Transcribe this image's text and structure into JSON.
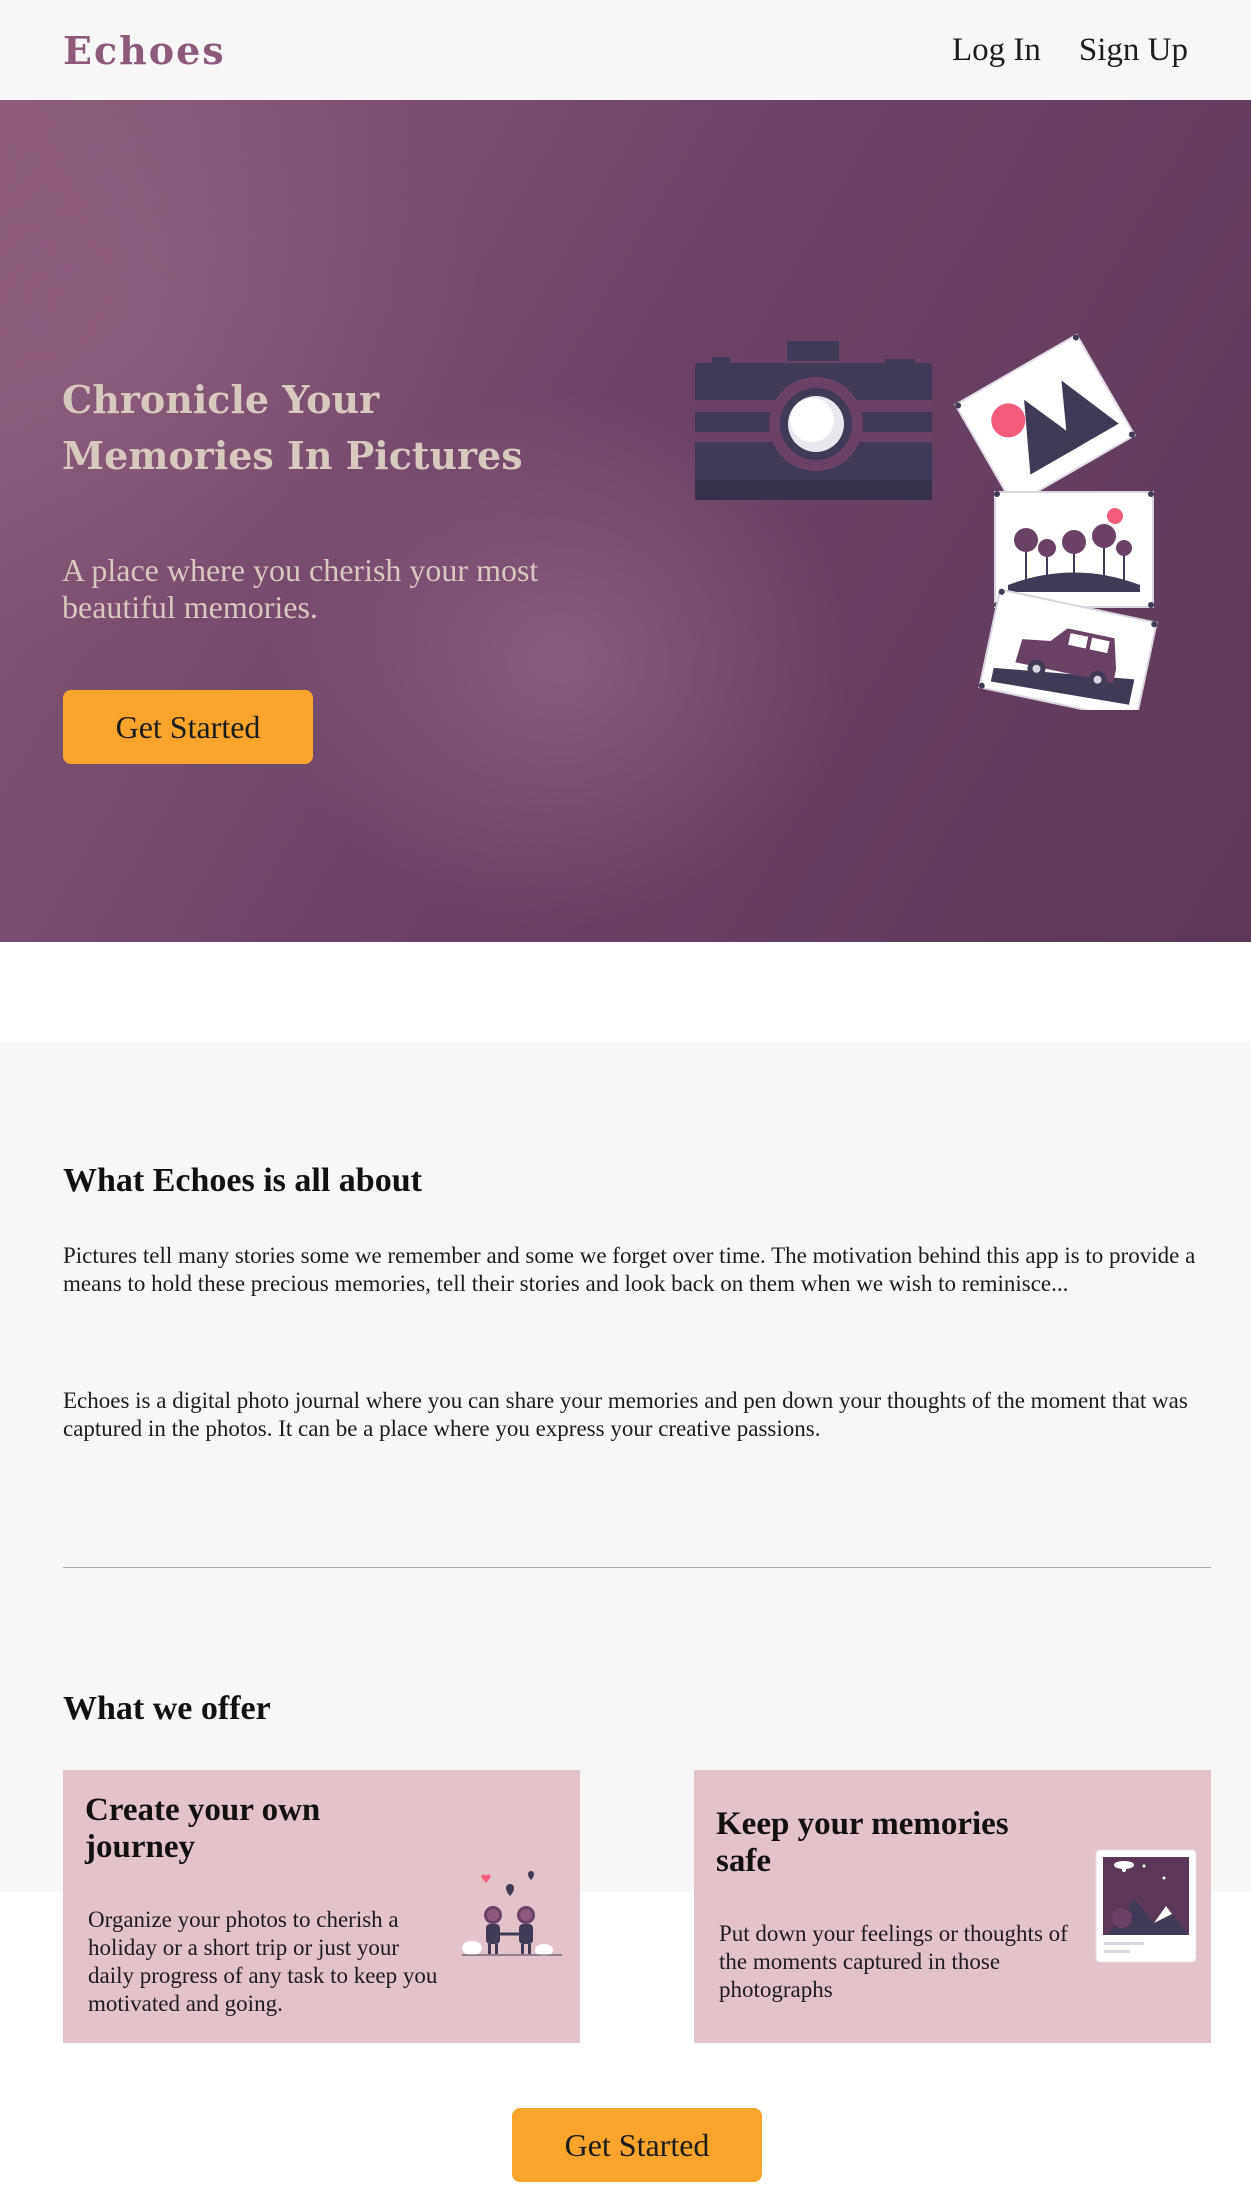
{
  "nav": {
    "brand": "Echoes",
    "login": "Log In",
    "signup": "Sign Up"
  },
  "hero": {
    "title": "Chronicle Your Memories In Pictures",
    "subtitle": "A place where you cherish your most beautiful memories.",
    "cta": "Get Started"
  },
  "about": {
    "heading": "What Echoes is all about",
    "paragraphs": [
      "Pictures tell many stories some we remember and some we forget over time. The motivation behind this app is to provide a means to hold these precious memories, tell their stories and look back on them when we wish to reminisce...",
      "Echoes is a digital photo journal where you can share your memories and pen down your thoughts of the moment that was captured in the photos. It can be a place where you express your creative passions."
    ]
  },
  "offer": {
    "heading": "What we offer",
    "cards": [
      {
        "title": "Create your own journey",
        "text": "Organize your photos to cherish a holiday or a short trip or just your daily progress of any task to keep you motivated and going."
      },
      {
        "title": "Keep your memories safe",
        "text": "Put down your feelings or thoughts of the moments captured in those photographs"
      }
    ]
  },
  "footer_cta": "Get Started",
  "colors": {
    "brand": "#8d5a7c",
    "hero_bg": "#6d4468",
    "accent": "#f9a42a",
    "card_bg": "#e2c3c9",
    "section_bg": "#f7f7f7"
  }
}
